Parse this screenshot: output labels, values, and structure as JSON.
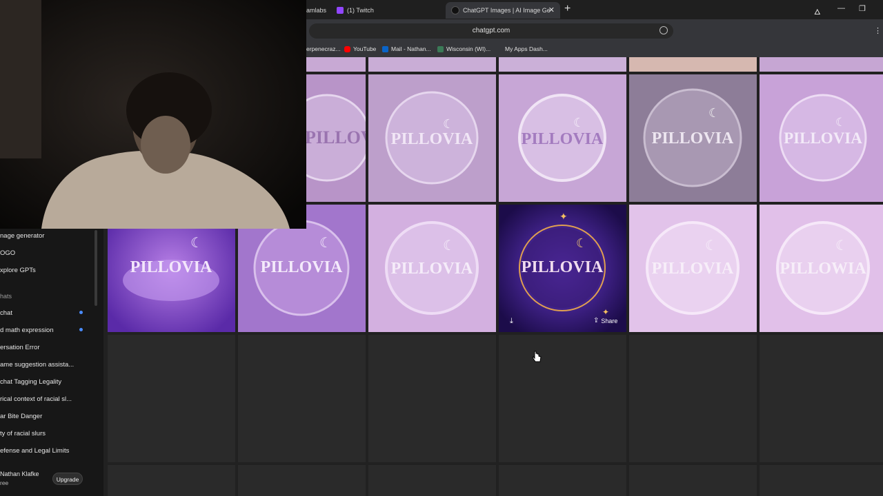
{
  "browser": {
    "tabs": [
      {
        "label": "amlabs"
      },
      {
        "label": "(1) Twitch"
      },
      {
        "label": "ChatGPT Images | AI Image Ge",
        "active": true
      }
    ],
    "url": "chatgpt.com",
    "bookmarks": [
      {
        "label": "erpenecraz..."
      },
      {
        "label": "YouTube"
      },
      {
        "label": "Mail - Nathan..."
      },
      {
        "label": "Wisconsin (WI)..."
      },
      {
        "label": "My Apps Dash..."
      }
    ]
  },
  "sidebar": {
    "items": [
      {
        "label": "nage generator"
      },
      {
        "label": "OGO"
      },
      {
        "label": "xplore GPTs"
      }
    ],
    "section_label": "hats",
    "chats": [
      {
        "label": "chat",
        "unread": true
      },
      {
        "label": "d math expression",
        "unread": true
      },
      {
        "label": "ersation Error"
      },
      {
        "label": "ame suggestion assista..."
      },
      {
        "label": "chat Tagging Legality"
      },
      {
        "label": "rical context of racial sl..."
      },
      {
        "label": "ar Bite Danger"
      },
      {
        "label": "ty of racial slurs"
      },
      {
        "label": "efense and Legal Limits"
      }
    ],
    "user": {
      "name": "Nathan Klafke",
      "plan": "ree"
    },
    "upgrade_label": "Upgrade"
  },
  "gallery": {
    "row1": [
      {
        "text": "PILLOVIA"
      },
      {
        "text": "PILLOVIA"
      },
      {
        "text": "PILLOVIA"
      },
      {
        "text": "PILLOVIA"
      },
      {
        "text": "PILLOVIA"
      }
    ],
    "row2": [
      {
        "text": "PILLOVIA"
      },
      {
        "text": "PILLOVIA"
      },
      {
        "text": "PILLOVIA"
      },
      {
        "text": "PILLOVIA"
      },
      {
        "text": "PILLOVIA"
      },
      {
        "text": "PILLOWIA"
      }
    ],
    "share_label": "Share"
  },
  "colors": {
    "accent_unread": "#4a8cff",
    "lavender": "#c8a8d8",
    "deep_purple": "#3a1c78"
  }
}
